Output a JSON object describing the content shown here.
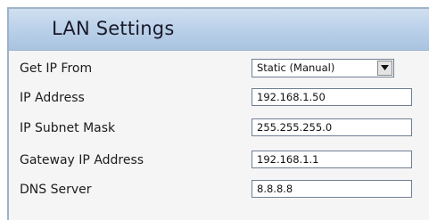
{
  "section": {
    "title": "LAN Settings"
  },
  "fields": {
    "get_ip_from": {
      "label": "Get IP From",
      "value": "Static (Manual)"
    },
    "ip_address": {
      "label": "IP Address",
      "value": "192.168.1.50"
    },
    "subnet_mask": {
      "label": "IP Subnet Mask",
      "value": "255.255.255.0"
    },
    "gateway": {
      "label": "Gateway IP Address",
      "value": "192.168.1.1"
    },
    "dns": {
      "label": "DNS Server",
      "value": "8.8.8.8"
    }
  },
  "icons": {
    "dropdown": "chevron-down-icon"
  },
  "colors": {
    "header_bg": "#bcd2ea",
    "panel_bg": "#f5f5f5",
    "border": "#9fb3c8"
  }
}
